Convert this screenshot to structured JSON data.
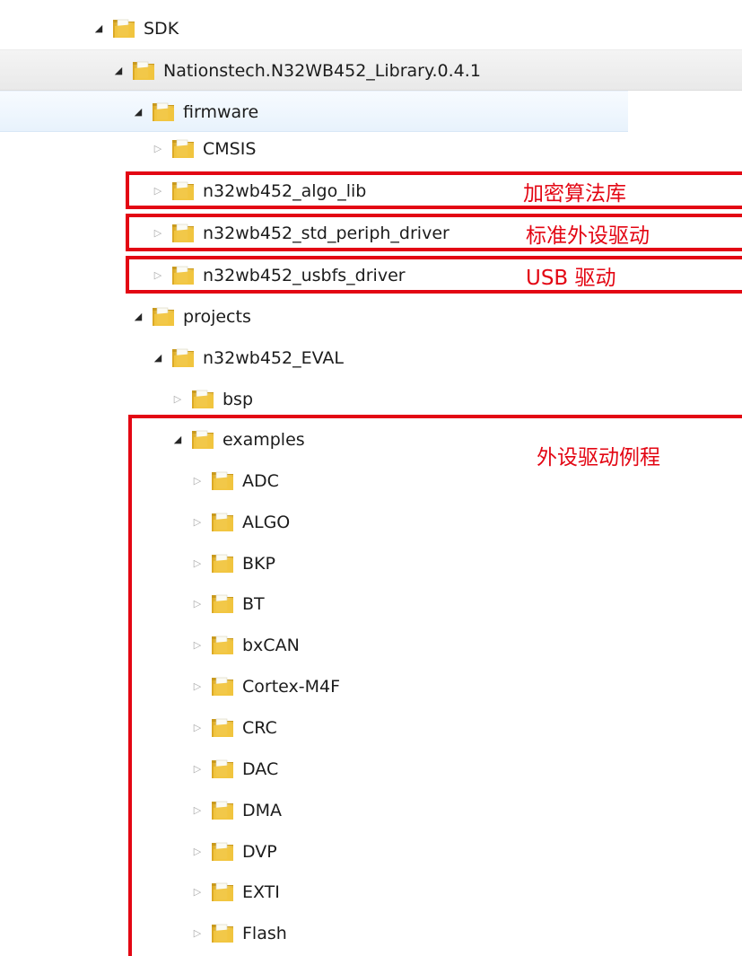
{
  "tree": {
    "rows": [
      {
        "label": "SDK",
        "state": "expanded"
      },
      {
        "label": "Nationstech.N32WB452_Library.0.4.1",
        "state": "expanded"
      },
      {
        "label": "firmware",
        "state": "expanded"
      },
      {
        "label": "CMSIS",
        "state": "collapsed"
      },
      {
        "label": "n32wb452_algo_lib",
        "state": "collapsed"
      },
      {
        "label": "n32wb452_std_periph_driver",
        "state": "collapsed"
      },
      {
        "label": "n32wb452_usbfs_driver",
        "state": "collapsed"
      },
      {
        "label": "projects",
        "state": "expanded"
      },
      {
        "label": "n32wb452_EVAL",
        "state": "expanded"
      },
      {
        "label": "bsp",
        "state": "collapsed"
      },
      {
        "label": "examples",
        "state": "expanded"
      },
      {
        "label": "ADC",
        "state": "collapsed"
      },
      {
        "label": "ALGO",
        "state": "collapsed"
      },
      {
        "label": "BKP",
        "state": "collapsed"
      },
      {
        "label": "BT",
        "state": "collapsed"
      },
      {
        "label": "bxCAN",
        "state": "collapsed"
      },
      {
        "label": "Cortex-M4F",
        "state": "collapsed"
      },
      {
        "label": "CRC",
        "state": "collapsed"
      },
      {
        "label": "DAC",
        "state": "collapsed"
      },
      {
        "label": "DMA",
        "state": "collapsed"
      },
      {
        "label": "DVP",
        "state": "collapsed"
      },
      {
        "label": "EXTI",
        "state": "collapsed"
      },
      {
        "label": "Flash",
        "state": "collapsed"
      }
    ]
  },
  "annotations": {
    "algo_lib": "加密算法库",
    "std_periph": "标准外设驱动",
    "usb": "USB 驱动",
    "examples": "外设驱动例程"
  },
  "colors": {
    "annotation_red": "#e30613",
    "folder_yellow": "#f2c94c",
    "row_highlight_blue": "#e8f2fc"
  },
  "icons": {
    "expanded": "triangle-down-right-icon",
    "collapsed": "triangle-right-outline-icon",
    "folder": "folder-icon"
  }
}
